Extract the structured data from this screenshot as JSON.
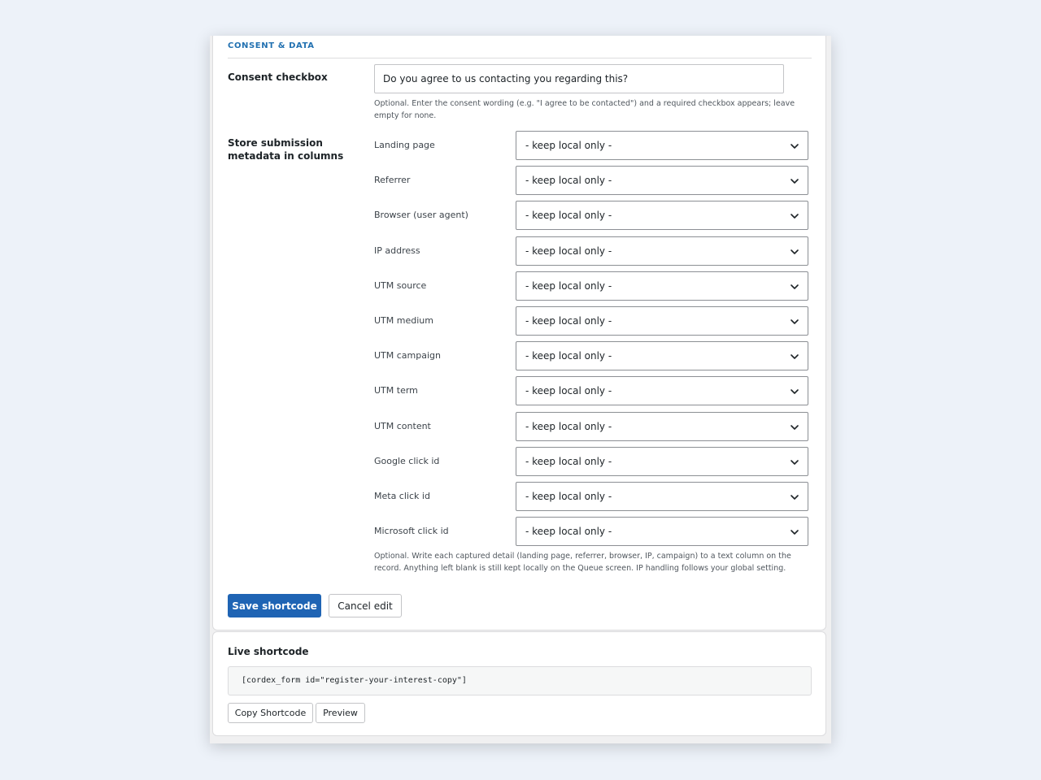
{
  "section": {
    "heading": "CONSENT & DATA"
  },
  "consent": {
    "label": "Consent checkbox",
    "value": "Do you agree to us contacting you regarding this?",
    "help": "Optional. Enter the consent wording (e.g. \"I agree to be contacted\") and a required checkbox appears; leave empty for none."
  },
  "metadata": {
    "label": "Store submission metadata in columns",
    "rows": [
      {
        "label": "Landing page",
        "value": "- keep local only -"
      },
      {
        "label": "Referrer",
        "value": "- keep local only -"
      },
      {
        "label": "Browser (user agent)",
        "value": "- keep local only -"
      },
      {
        "label": "IP address",
        "value": "- keep local only -"
      },
      {
        "label": "UTM source",
        "value": "- keep local only -"
      },
      {
        "label": "UTM medium",
        "value": "- keep local only -"
      },
      {
        "label": "UTM campaign",
        "value": "- keep local only -"
      },
      {
        "label": "UTM term",
        "value": "- keep local only -"
      },
      {
        "label": "UTM content",
        "value": "- keep local only -"
      },
      {
        "label": "Google click id",
        "value": "- keep local only -"
      },
      {
        "label": "Meta click id",
        "value": "- keep local only -"
      },
      {
        "label": "Microsoft click id",
        "value": "- keep local only -"
      }
    ],
    "help": "Optional. Write each captured detail (landing page, referrer, browser, IP, campaign) to a text column on the record. Anything left blank is still kept locally on the Queue screen. IP handling follows your global setting."
  },
  "actions": {
    "save_label": "Save shortcode",
    "cancel_label": "Cancel edit"
  },
  "live": {
    "heading": "Live shortcode",
    "code": "[cordex_form id=\"register-your-interest-copy\"]",
    "copy_label": "Copy Shortcode",
    "preview_label": "Preview"
  },
  "colors": {
    "accent": "#1f64b4",
    "heading": "#2271b1",
    "background": "#edf2f9"
  }
}
